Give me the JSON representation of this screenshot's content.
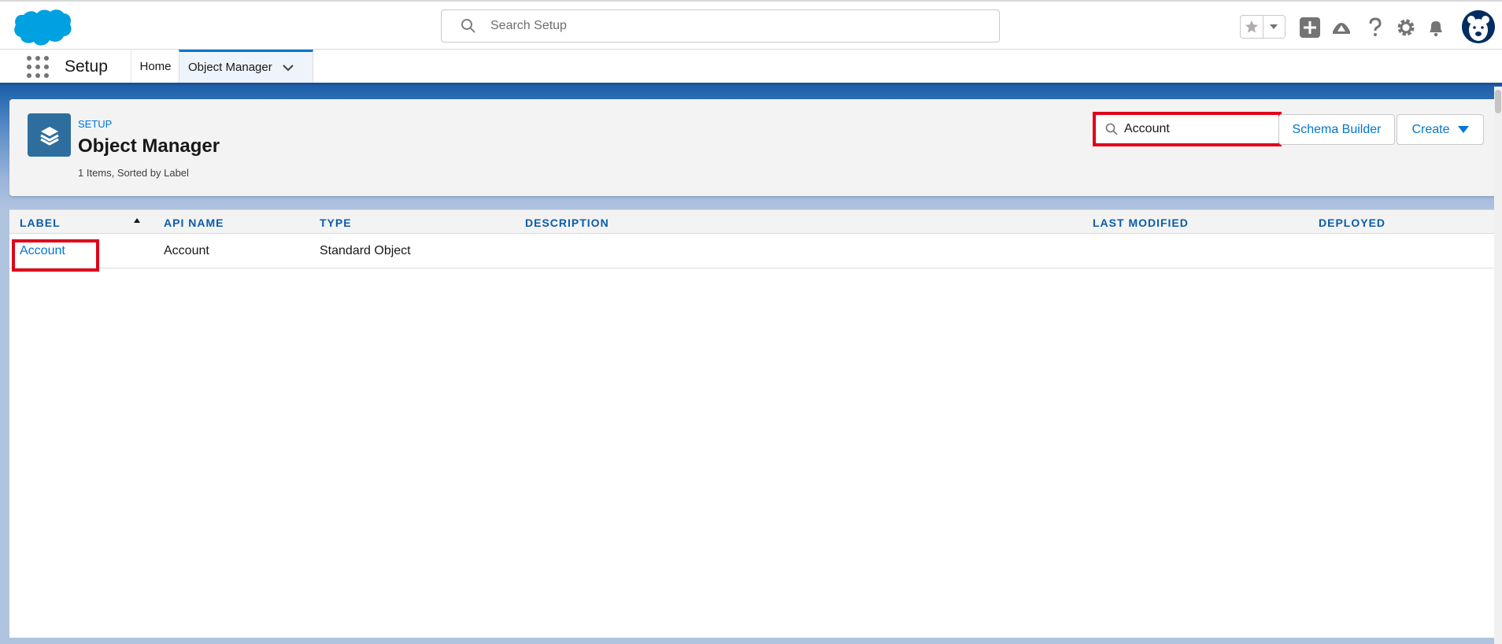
{
  "global_header": {
    "search_placeholder": "Search Setup"
  },
  "context_bar": {
    "app_name": "Setup",
    "tabs": [
      {
        "label": "Home"
      },
      {
        "label": "Object Manager"
      }
    ]
  },
  "page_header": {
    "eyebrow": "SETUP",
    "title": "Object Manager",
    "meta": "1 Items, Sorted by Label",
    "quick_find_value": "Account",
    "schema_builder_label": "Schema Builder",
    "create_label": "Create"
  },
  "table": {
    "columns": [
      "LABEL",
      "API NAME",
      "TYPE",
      "DESCRIPTION",
      "LAST MODIFIED",
      "DEPLOYED"
    ],
    "rows": [
      {
        "label": "Account",
        "api_name": "Account",
        "type": "Standard Object",
        "description": "",
        "last_modified": "",
        "deployed": ""
      }
    ]
  },
  "colors": {
    "brand_blue": "#0176d3",
    "highlight_red": "#e2001a",
    "header_band": "#1b5297"
  }
}
